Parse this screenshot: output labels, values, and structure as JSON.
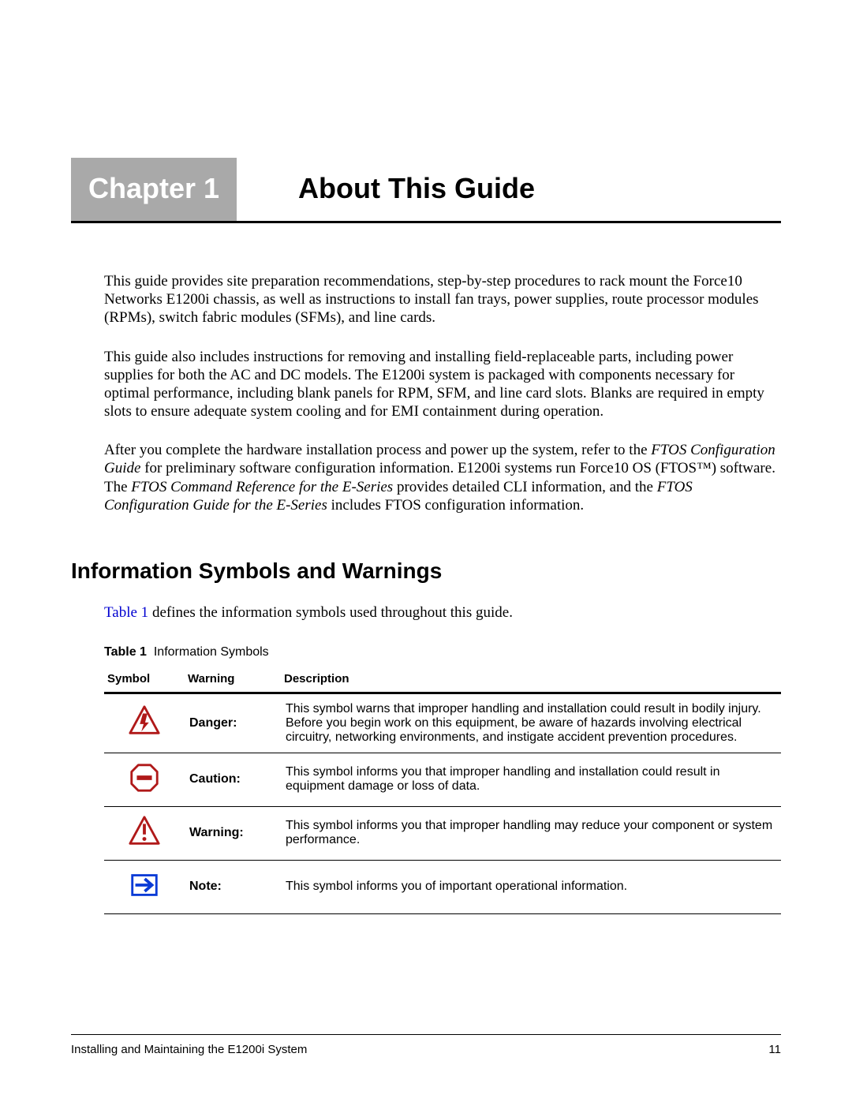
{
  "chapter": {
    "badge": "Chapter 1",
    "title": "About This Guide"
  },
  "paragraphs": {
    "p1": "This guide provides site preparation recommendations, step-by-step procedures to rack mount the Force10 Networks E1200i chassis, as well as instructions to install fan trays, power supplies, route processor modules (RPMs), switch fabric modules (SFMs), and line cards.",
    "p2": "This guide also includes instructions for removing and installing field-replaceable parts, including power supplies for both the AC and DC models. The E1200i system is packaged with components necessary for optimal performance, including blank panels for RPM, SFM, and line card slots. Blanks are required in empty slots to ensure adequate system cooling and for EMI containment during operation.",
    "p3_a": "After you complete the hardware installation process and power up the system, refer to the ",
    "p3_i1": "FTOS Configuration Guide",
    "p3_b": " for preliminary software configuration information. E1200i systems run Force10 OS (FTOS™) software. The ",
    "p3_i2": "FTOS Command Reference for the E-Series",
    "p3_c": " provides detailed CLI information, and the ",
    "p3_i3": "FTOS Configuration Guide for the E-Series",
    "p3_d": " includes FTOS configuration information."
  },
  "section_heading": "Information Symbols and Warnings",
  "section_intro_xref": "Table 1",
  "section_intro_rest": " defines the information symbols used throughout this guide.",
  "table": {
    "caption_label": "Table 1",
    "caption_text": "Information Symbols",
    "headers": {
      "c1": "Symbol",
      "c2": "Warning",
      "c3": "Description"
    },
    "rows": [
      {
        "warning": "Danger:",
        "desc": "This symbol warns that improper handling and installation could result in bodily injury. Before you begin work on this equipment, be aware of hazards involving electrical circuitry, networking environments, and instigate accident prevention procedures."
      },
      {
        "warning": "Caution:",
        "desc": "This symbol informs you that improper handling and installation could result in equipment damage or loss of data."
      },
      {
        "warning": "Warning:",
        "desc": "This symbol informs you that improper handling may reduce your component or system performance."
      },
      {
        "warning": "Note:",
        "desc": "This symbol informs you of important operational information."
      }
    ]
  },
  "footer": {
    "doc_title": "Installing and Maintaining the E1200i System",
    "page_number": "11"
  }
}
